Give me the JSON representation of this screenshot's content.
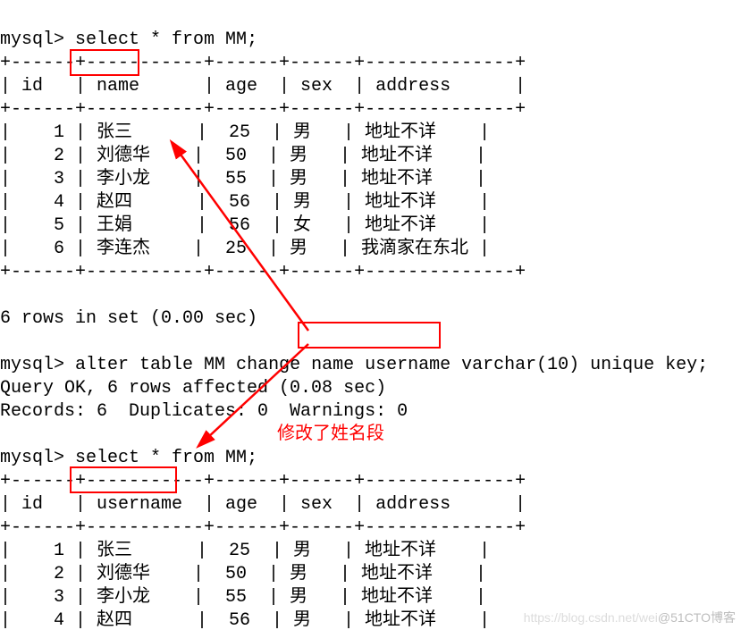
{
  "prompt": "mysql>",
  "cmd1": "select * from MM;",
  "table1": {
    "border": "+------+-----------+------+------+--------------+",
    "header": "| id   | name      | age  | sex  | address      |",
    "rows": [
      "|    1 | 张三      |  25  | 男   | 地址不详    |",
      "|    2 | 刘德华    |  50  | 男   | 地址不详    |",
      "|    3 | 李小龙    |  55  | 男   | 地址不详    |",
      "|    4 | 赵四      |  56  | 男   | 地址不详    |",
      "|    5 | 王娟      |  56  | 女   | 地址不详    |",
      "|    6 | 李连杰    |  25  | 男   | 我滴家在东北 |"
    ]
  },
  "rows_msg": "6 rows in set (0.00 sec)",
  "cmd2": "alter table MM change name username varchar(10) unique key;",
  "cmd2_res": [
    "Query OK, 6 rows affected (0.08 sec)",
    "Records: 6  Duplicates: 0  Warnings: 0"
  ],
  "cmd3": "select * from MM;",
  "annotation": "修改了姓名段",
  "table2": {
    "border": "+------+-----------+------+------+--------------+",
    "header": "| id   | username  | age  | sex  | address      |",
    "rows": [
      "|    1 | 张三      |  25  | 男   | 地址不详    |",
      "|    2 | 刘德华    |  50  | 男   | 地址不详    |",
      "|    3 | 李小龙    |  55  | 男   | 地址不详    |",
      "|    4 | 赵四      |  56  | 男   | 地址不详    |"
    ]
  },
  "watermark_faint": "https://blog.csdn.net/wei",
  "watermark": "@51CTO博客",
  "data_view": {
    "queries": [
      {
        "sql": "select * from MM;",
        "result_rows": 6,
        "time_sec": 0.0
      },
      {
        "sql": "alter table MM change name username varchar(10) unique key;",
        "rows_affected": 6,
        "time_sec": 0.08,
        "duplicates": 0,
        "warnings": 0
      },
      {
        "sql": "select * from MM;"
      }
    ],
    "before": {
      "columns": [
        "id",
        "name",
        "age",
        "sex",
        "address"
      ],
      "rows": [
        {
          "id": 1,
          "name": "张三",
          "age": 25,
          "sex": "男",
          "address": "地址不详"
        },
        {
          "id": 2,
          "name": "刘德华",
          "age": 50,
          "sex": "男",
          "address": "地址不详"
        },
        {
          "id": 3,
          "name": "李小龙",
          "age": 55,
          "sex": "男",
          "address": "地址不详"
        },
        {
          "id": 4,
          "name": "赵四",
          "age": 56,
          "sex": "男",
          "address": "地址不详"
        },
        {
          "id": 5,
          "name": "王娟",
          "age": 56,
          "sex": "女",
          "address": "地址不详"
        },
        {
          "id": 6,
          "name": "李连杰",
          "age": 25,
          "sex": "男",
          "address": "我滴家在东北"
        }
      ]
    },
    "after_visible": {
      "columns": [
        "id",
        "username",
        "age",
        "sex",
        "address"
      ],
      "rows": [
        {
          "id": 1,
          "username": "张三",
          "age": 25,
          "sex": "男",
          "address": "地址不详"
        },
        {
          "id": 2,
          "username": "刘德华",
          "age": 50,
          "sex": "男",
          "address": "地址不详"
        },
        {
          "id": 3,
          "username": "李小龙",
          "age": 55,
          "sex": "男",
          "address": "地址不详"
        },
        {
          "id": 4,
          "username": "赵四",
          "age": 56,
          "sex": "男",
          "address": "地址不详"
        }
      ]
    },
    "note_zh": "修改了姓名段"
  }
}
